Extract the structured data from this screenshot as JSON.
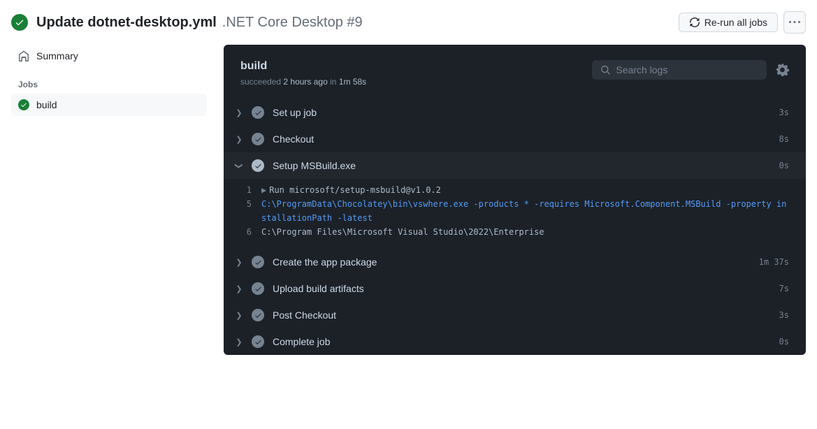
{
  "header": {
    "title_main": "Update dotnet-desktop.yml",
    "title_sub": ".NET Core Desktop #9",
    "rerun_label": "Re-run all jobs"
  },
  "sidebar": {
    "summary_label": "Summary",
    "jobs_heading": "Jobs",
    "job_name": "build"
  },
  "log": {
    "title": "build",
    "status_word": "succeeded",
    "time_ago": "2 hours ago",
    "in_word": "in",
    "duration": "1m 58s",
    "search_placeholder": "Search logs"
  },
  "steps": [
    {
      "name": "Set up job",
      "time": "3s",
      "expanded": false
    },
    {
      "name": "Checkout",
      "time": "8s",
      "expanded": false
    },
    {
      "name": "Setup MSBuild.exe",
      "time": "0s",
      "expanded": true
    },
    {
      "name": "Create the app package",
      "time": "1m 37s",
      "expanded": false
    },
    {
      "name": "Upload build artifacts",
      "time": "7s",
      "expanded": false
    },
    {
      "name": "Post Checkout",
      "time": "3s",
      "expanded": false
    },
    {
      "name": "Complete job",
      "time": "0s",
      "expanded": false
    }
  ],
  "log_lines": [
    {
      "n": "1",
      "cls": "run",
      "text": "Run microsoft/setup-msbuild@v1.0.2"
    },
    {
      "n": "5",
      "cls": "cmd",
      "text": "C:\\ProgramData\\Chocolatey\\bin\\vswhere.exe -products * -requires Microsoft.Component.MSBuild -property installationPath -latest"
    },
    {
      "n": "6",
      "cls": "",
      "text": "C:\\Program Files\\Microsoft Visual Studio\\2022\\Enterprise"
    }
  ]
}
